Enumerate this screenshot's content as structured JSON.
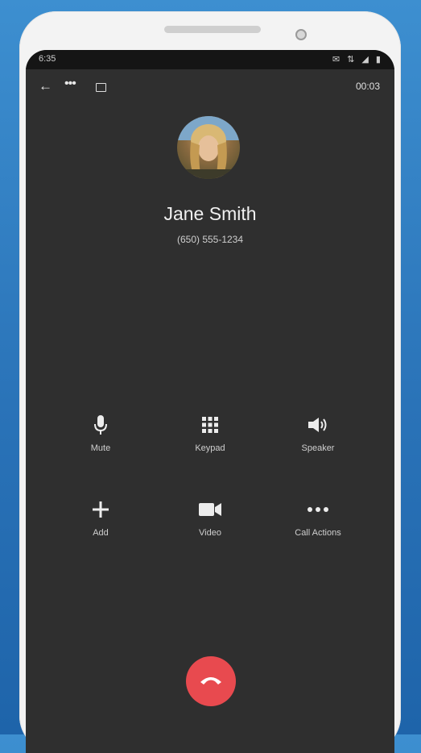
{
  "status_bar": {
    "time": "6:35",
    "icons": "✉ ⇅ ◢ ▮"
  },
  "toolbar": {
    "timer": "00:03"
  },
  "contact": {
    "name": "Jane Smith",
    "number": "(650) 555-1234"
  },
  "actions": [
    {
      "label": "Mute",
      "icon": "microphone-icon"
    },
    {
      "label": "Keypad",
      "icon": "keypad-icon"
    },
    {
      "label": "Speaker",
      "icon": "speaker-icon"
    },
    {
      "label": "Add",
      "icon": "plus-icon"
    },
    {
      "label": "Video",
      "icon": "video-camera-icon"
    },
    {
      "label": "Call Actions",
      "icon": "more-horizontal-icon"
    }
  ],
  "colors": {
    "screen_bg": "#2f2f2f",
    "end_call": "#e84a4f",
    "frame_bg": "#2a73b8"
  }
}
